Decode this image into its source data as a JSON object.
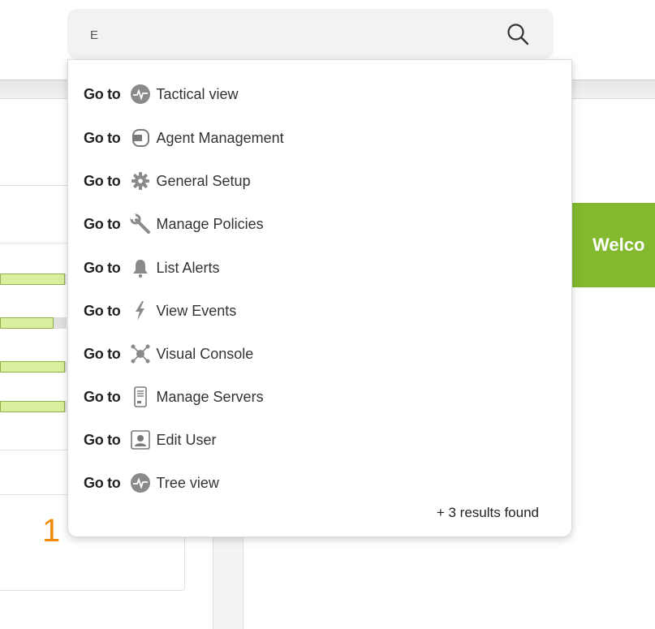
{
  "search": {
    "value": "E",
    "placeholder": ""
  },
  "results": [
    {
      "prefix": "Go to",
      "label": "Tactical view",
      "icon": "tactical-view-icon"
    },
    {
      "prefix": "Go to",
      "label": "Agent Management",
      "icon": "agent-management-icon"
    },
    {
      "prefix": "Go to",
      "label": "General Setup",
      "icon": "gear-icon"
    },
    {
      "prefix": "Go to",
      "label": "Manage Policies",
      "icon": "wrench-icon"
    },
    {
      "prefix": "Go to",
      "label": "List Alerts",
      "icon": "bell-icon"
    },
    {
      "prefix": "Go to",
      "label": "View Events",
      "icon": "lightning-icon"
    },
    {
      "prefix": "Go to",
      "label": "Visual Console",
      "icon": "network-console-icon"
    },
    {
      "prefix": "Go to",
      "label": "Manage Servers",
      "icon": "server-icon"
    },
    {
      "prefix": "Go to",
      "label": "Edit User",
      "icon": "user-card-icon"
    },
    {
      "prefix": "Go to",
      "label": "Tree view",
      "icon": "tree-view-icon"
    }
  ],
  "results_more": "+ 3 results found",
  "background": {
    "welcome_text": "Welco",
    "count_value": "1",
    "bars": [
      0.98,
      0.8,
      0.98,
      0.98
    ]
  },
  "colors": {
    "accent_green": "#82b92e",
    "count_orange": "#f28c0f",
    "icon_gray": "#8a8a8a"
  }
}
